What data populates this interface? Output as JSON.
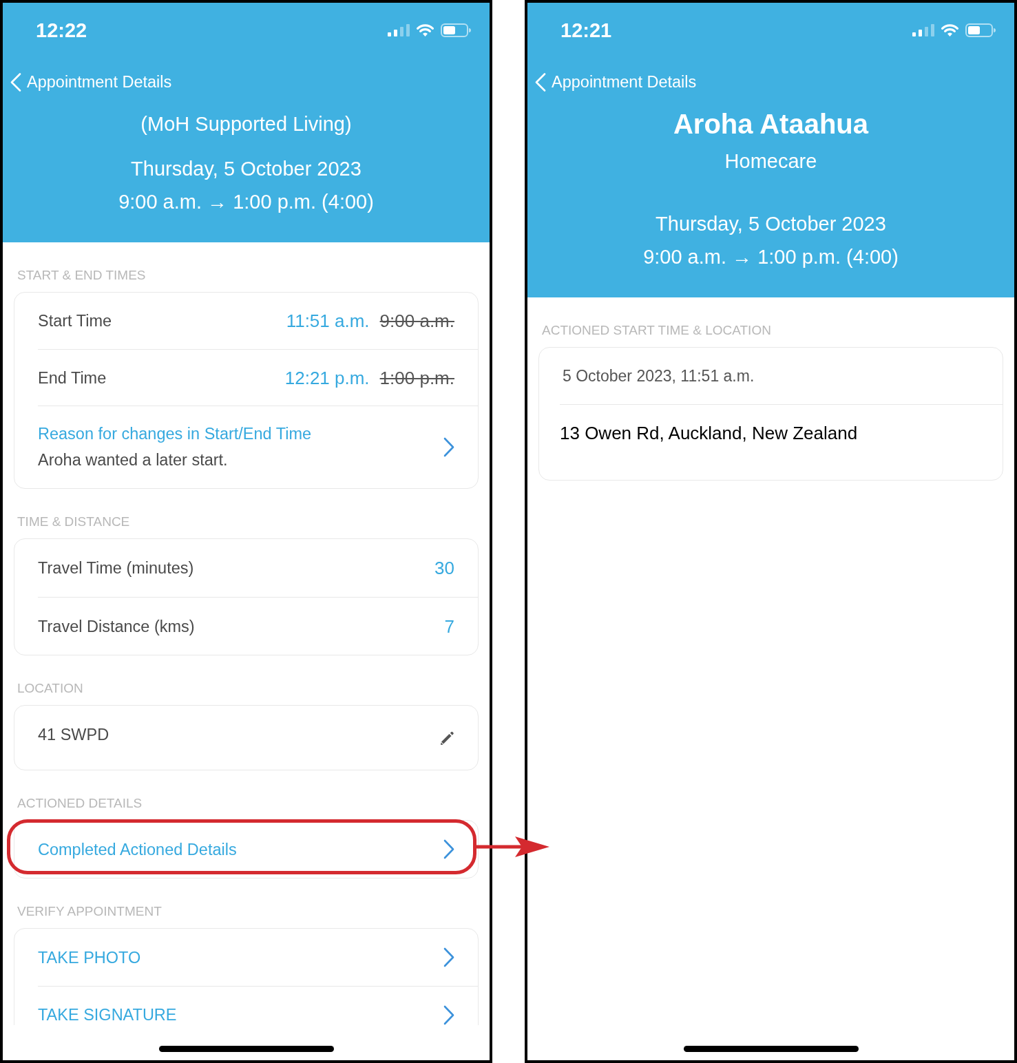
{
  "screens": [
    {
      "status_bar": {
        "time": "12:22"
      },
      "nav": {
        "back_label": "Appointment Details"
      },
      "header": {
        "subtitle": "(MoH Supported Living)",
        "date": "Thursday, 5 October 2023",
        "time_range": "9:00 a.m. → 1:00 p.m. (4:00)"
      },
      "sections": [
        {
          "heading": "START & END TIMES",
          "highlighted": false,
          "rows": [
            {
              "kind": "time_change",
              "label": "Start Time",
              "actual": "11:51 a.m.",
              "scheduled": "9:00 a.m."
            },
            {
              "kind": "time_change",
              "label": "End Time",
              "actual": "12:21 p.m.",
              "scheduled": "1:00 p.m."
            },
            {
              "kind": "link",
              "label": "Reason for changes in Start/End Time",
              "note": "Aroha wanted a later start."
            }
          ]
        },
        {
          "heading": "TIME & DISTANCE",
          "highlighted": false,
          "rows": [
            {
              "kind": "value",
              "label": "Travel Time (minutes)",
              "value": "30"
            },
            {
              "kind": "value",
              "label": "Travel Distance (kms)",
              "value": "7"
            }
          ]
        },
        {
          "heading": "LOCATION",
          "highlighted": false,
          "rows": [
            {
              "kind": "editable",
              "label": "41 SWPD"
            }
          ]
        },
        {
          "heading": "ACTIONED DETAILS",
          "highlighted": true,
          "rows": [
            {
              "kind": "link",
              "label": "Completed Actioned Details"
            }
          ]
        },
        {
          "heading": "VERIFY APPOINTMENT",
          "highlighted": false,
          "rows": [
            {
              "kind": "link",
              "label": "TAKE PHOTO"
            },
            {
              "kind": "link",
              "label": "TAKE SIGNATURE"
            }
          ]
        }
      ]
    },
    {
      "status_bar": {
        "time": "12:21"
      },
      "nav": {
        "back_label": "Appointment Details"
      },
      "header": {
        "title": "Aroha Ataahua",
        "subtitle": "Homecare",
        "date": "Thursday, 5 October 2023",
        "time_range": "9:00 a.m. → 1:00 p.m. (4:00)"
      },
      "sections": [
        {
          "heading": "ACTIONED START TIME & LOCATION",
          "highlighted": false,
          "rows": [
            {
              "kind": "text",
              "label": "5 October 2023, 11:51 a.m."
            },
            {
              "kind": "address",
              "label": "13 Owen Rd, Auckland, New Zealand"
            }
          ]
        }
      ]
    }
  ]
}
